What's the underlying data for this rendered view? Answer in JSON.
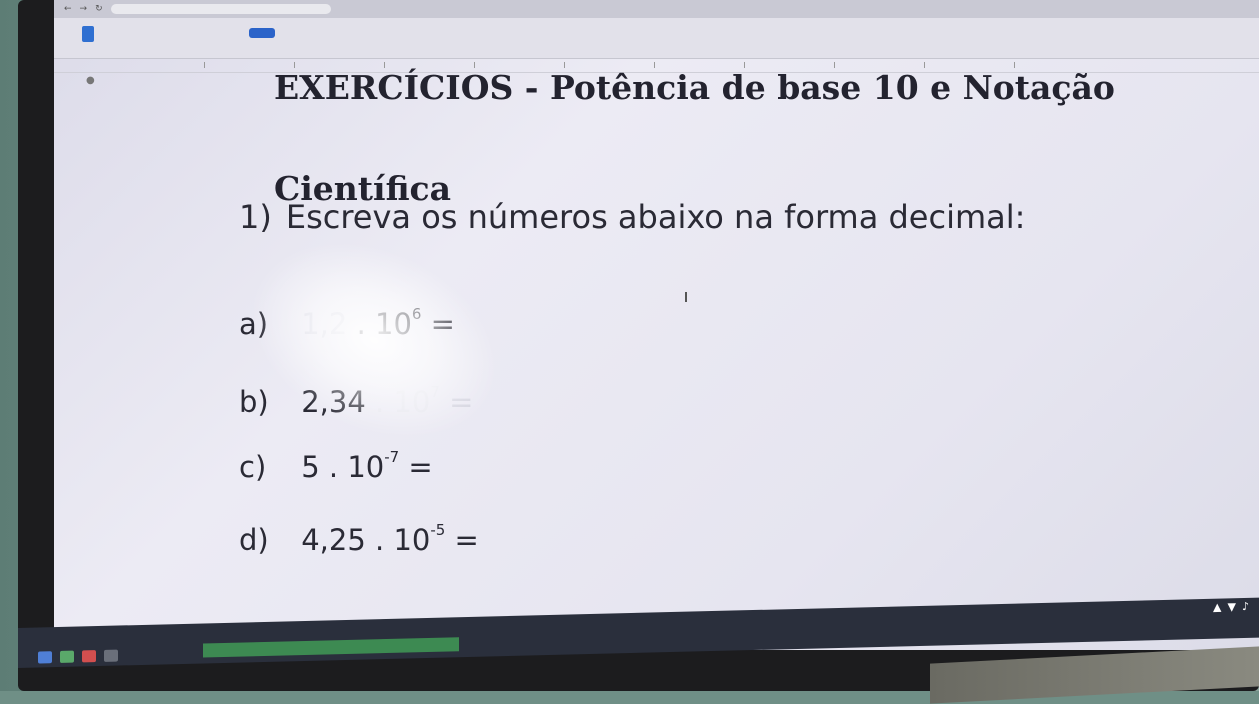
{
  "document": {
    "title_line1": "EXERCÍCIOS - Potência de base 10 e Notação",
    "title_line2": "Científica",
    "question": {
      "number": "1)",
      "text": "Escreva os números abaixo na forma decimal:"
    },
    "items": [
      {
        "letter": "a)",
        "coefficient": "1,2",
        "base": ". 10",
        "exponent": "6",
        "equals": "="
      },
      {
        "letter": "b)",
        "coefficient": "2,34",
        "base": ". 10",
        "exponent": "7",
        "equals": "="
      },
      {
        "letter": "c)",
        "coefficient": "5",
        "base": ". 10",
        "exponent": "-7",
        "equals": "="
      },
      {
        "letter": "d)",
        "coefficient": "4,25",
        "base": ". 10",
        "exponent": "-5",
        "equals": "="
      }
    ]
  },
  "colors": {
    "page": "#e8e7f1",
    "text": "#23232f",
    "docs_blue": "#2f6fd1",
    "taskbar": "#2a2f3c"
  },
  "icons": [
    "docs-icon",
    "share-icon",
    "outline-icon",
    "wifi-icon",
    "volume-icon",
    "notification-icon"
  ]
}
